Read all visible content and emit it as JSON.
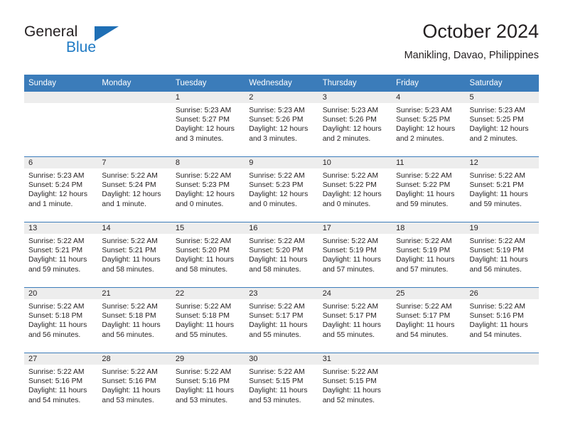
{
  "brand": {
    "name_part1": "General",
    "name_part2": "Blue"
  },
  "header": {
    "title": "October 2024",
    "location": "Manikling, Davao, Philippines"
  },
  "colors": {
    "header_blue": "#3b7cba",
    "logo_blue": "#1f7ac4",
    "daynum_band": "#ededed",
    "text": "#231f20"
  },
  "weekday_headers": [
    "Sunday",
    "Monday",
    "Tuesday",
    "Wednesday",
    "Thursday",
    "Friday",
    "Saturday"
  ],
  "weeks": [
    [
      {
        "day": "",
        "empty": true
      },
      {
        "day": "",
        "empty": true
      },
      {
        "day": "1",
        "sunrise": "Sunrise: 5:23 AM",
        "sunset": "Sunset: 5:27 PM",
        "daylight_line1": "Daylight: 12 hours",
        "daylight_line2": "and 3 minutes."
      },
      {
        "day": "2",
        "sunrise": "Sunrise: 5:23 AM",
        "sunset": "Sunset: 5:26 PM",
        "daylight_line1": "Daylight: 12 hours",
        "daylight_line2": "and 3 minutes."
      },
      {
        "day": "3",
        "sunrise": "Sunrise: 5:23 AM",
        "sunset": "Sunset: 5:26 PM",
        "daylight_line1": "Daylight: 12 hours",
        "daylight_line2": "and 2 minutes."
      },
      {
        "day": "4",
        "sunrise": "Sunrise: 5:23 AM",
        "sunset": "Sunset: 5:25 PM",
        "daylight_line1": "Daylight: 12 hours",
        "daylight_line2": "and 2 minutes."
      },
      {
        "day": "5",
        "sunrise": "Sunrise: 5:23 AM",
        "sunset": "Sunset: 5:25 PM",
        "daylight_line1": "Daylight: 12 hours",
        "daylight_line2": "and 2 minutes."
      }
    ],
    [
      {
        "day": "6",
        "sunrise": "Sunrise: 5:23 AM",
        "sunset": "Sunset: 5:24 PM",
        "daylight_line1": "Daylight: 12 hours",
        "daylight_line2": "and 1 minute."
      },
      {
        "day": "7",
        "sunrise": "Sunrise: 5:22 AM",
        "sunset": "Sunset: 5:24 PM",
        "daylight_line1": "Daylight: 12 hours",
        "daylight_line2": "and 1 minute."
      },
      {
        "day": "8",
        "sunrise": "Sunrise: 5:22 AM",
        "sunset": "Sunset: 5:23 PM",
        "daylight_line1": "Daylight: 12 hours",
        "daylight_line2": "and 0 minutes."
      },
      {
        "day": "9",
        "sunrise": "Sunrise: 5:22 AM",
        "sunset": "Sunset: 5:23 PM",
        "daylight_line1": "Daylight: 12 hours",
        "daylight_line2": "and 0 minutes."
      },
      {
        "day": "10",
        "sunrise": "Sunrise: 5:22 AM",
        "sunset": "Sunset: 5:22 PM",
        "daylight_line1": "Daylight: 12 hours",
        "daylight_line2": "and 0 minutes."
      },
      {
        "day": "11",
        "sunrise": "Sunrise: 5:22 AM",
        "sunset": "Sunset: 5:22 PM",
        "daylight_line1": "Daylight: 11 hours",
        "daylight_line2": "and 59 minutes."
      },
      {
        "day": "12",
        "sunrise": "Sunrise: 5:22 AM",
        "sunset": "Sunset: 5:21 PM",
        "daylight_line1": "Daylight: 11 hours",
        "daylight_line2": "and 59 minutes."
      }
    ],
    [
      {
        "day": "13",
        "sunrise": "Sunrise: 5:22 AM",
        "sunset": "Sunset: 5:21 PM",
        "daylight_line1": "Daylight: 11 hours",
        "daylight_line2": "and 59 minutes."
      },
      {
        "day": "14",
        "sunrise": "Sunrise: 5:22 AM",
        "sunset": "Sunset: 5:21 PM",
        "daylight_line1": "Daylight: 11 hours",
        "daylight_line2": "and 58 minutes."
      },
      {
        "day": "15",
        "sunrise": "Sunrise: 5:22 AM",
        "sunset": "Sunset: 5:20 PM",
        "daylight_line1": "Daylight: 11 hours",
        "daylight_line2": "and 58 minutes."
      },
      {
        "day": "16",
        "sunrise": "Sunrise: 5:22 AM",
        "sunset": "Sunset: 5:20 PM",
        "daylight_line1": "Daylight: 11 hours",
        "daylight_line2": "and 58 minutes."
      },
      {
        "day": "17",
        "sunrise": "Sunrise: 5:22 AM",
        "sunset": "Sunset: 5:19 PM",
        "daylight_line1": "Daylight: 11 hours",
        "daylight_line2": "and 57 minutes."
      },
      {
        "day": "18",
        "sunrise": "Sunrise: 5:22 AM",
        "sunset": "Sunset: 5:19 PM",
        "daylight_line1": "Daylight: 11 hours",
        "daylight_line2": "and 57 minutes."
      },
      {
        "day": "19",
        "sunrise": "Sunrise: 5:22 AM",
        "sunset": "Sunset: 5:19 PM",
        "daylight_line1": "Daylight: 11 hours",
        "daylight_line2": "and 56 minutes."
      }
    ],
    [
      {
        "day": "20",
        "sunrise": "Sunrise: 5:22 AM",
        "sunset": "Sunset: 5:18 PM",
        "daylight_line1": "Daylight: 11 hours",
        "daylight_line2": "and 56 minutes."
      },
      {
        "day": "21",
        "sunrise": "Sunrise: 5:22 AM",
        "sunset": "Sunset: 5:18 PM",
        "daylight_line1": "Daylight: 11 hours",
        "daylight_line2": "and 56 minutes."
      },
      {
        "day": "22",
        "sunrise": "Sunrise: 5:22 AM",
        "sunset": "Sunset: 5:18 PM",
        "daylight_line1": "Daylight: 11 hours",
        "daylight_line2": "and 55 minutes."
      },
      {
        "day": "23",
        "sunrise": "Sunrise: 5:22 AM",
        "sunset": "Sunset: 5:17 PM",
        "daylight_line1": "Daylight: 11 hours",
        "daylight_line2": "and 55 minutes."
      },
      {
        "day": "24",
        "sunrise": "Sunrise: 5:22 AM",
        "sunset": "Sunset: 5:17 PM",
        "daylight_line1": "Daylight: 11 hours",
        "daylight_line2": "and 55 minutes."
      },
      {
        "day": "25",
        "sunrise": "Sunrise: 5:22 AM",
        "sunset": "Sunset: 5:17 PM",
        "daylight_line1": "Daylight: 11 hours",
        "daylight_line2": "and 54 minutes."
      },
      {
        "day": "26",
        "sunrise": "Sunrise: 5:22 AM",
        "sunset": "Sunset: 5:16 PM",
        "daylight_line1": "Daylight: 11 hours",
        "daylight_line2": "and 54 minutes."
      }
    ],
    [
      {
        "day": "27",
        "sunrise": "Sunrise: 5:22 AM",
        "sunset": "Sunset: 5:16 PM",
        "daylight_line1": "Daylight: 11 hours",
        "daylight_line2": "and 54 minutes."
      },
      {
        "day": "28",
        "sunrise": "Sunrise: 5:22 AM",
        "sunset": "Sunset: 5:16 PM",
        "daylight_line1": "Daylight: 11 hours",
        "daylight_line2": "and 53 minutes."
      },
      {
        "day": "29",
        "sunrise": "Sunrise: 5:22 AM",
        "sunset": "Sunset: 5:16 PM",
        "daylight_line1": "Daylight: 11 hours",
        "daylight_line2": "and 53 minutes."
      },
      {
        "day": "30",
        "sunrise": "Sunrise: 5:22 AM",
        "sunset": "Sunset: 5:15 PM",
        "daylight_line1": "Daylight: 11 hours",
        "daylight_line2": "and 53 minutes."
      },
      {
        "day": "31",
        "sunrise": "Sunrise: 5:22 AM",
        "sunset": "Sunset: 5:15 PM",
        "daylight_line1": "Daylight: 11 hours",
        "daylight_line2": "and 52 minutes."
      },
      {
        "day": "",
        "empty": true
      },
      {
        "day": "",
        "empty": true
      }
    ]
  ]
}
